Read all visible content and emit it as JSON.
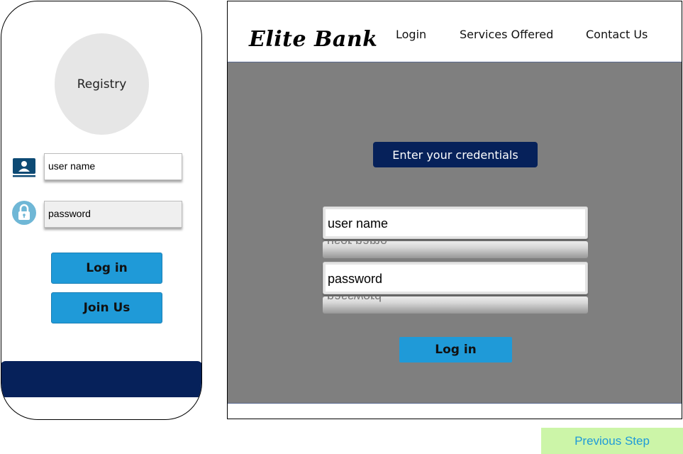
{
  "mobile": {
    "avatar_label": "Registry",
    "username_placeholder": "user name",
    "password_placeholder": "password",
    "login_label": "Log in",
    "join_label": "Join Us",
    "icons": {
      "user": "user-id-icon",
      "lock": "lock-icon"
    },
    "colors": {
      "button": "#1f9ad8",
      "footer": "#06215a"
    }
  },
  "desktop": {
    "brand": "Elite Bank",
    "nav": {
      "login": "Login",
      "services": "Services Offered",
      "contact": "Contact Us"
    },
    "credentials_title": "Enter your credentials",
    "username_placeholder": "user name",
    "password_placeholder": "password",
    "login_label": "Log in",
    "colors": {
      "panel": "#7f7f7f",
      "title_bg": "#06215a",
      "button": "#1f9ad8"
    }
  },
  "previous_step_label": "Previous Step"
}
